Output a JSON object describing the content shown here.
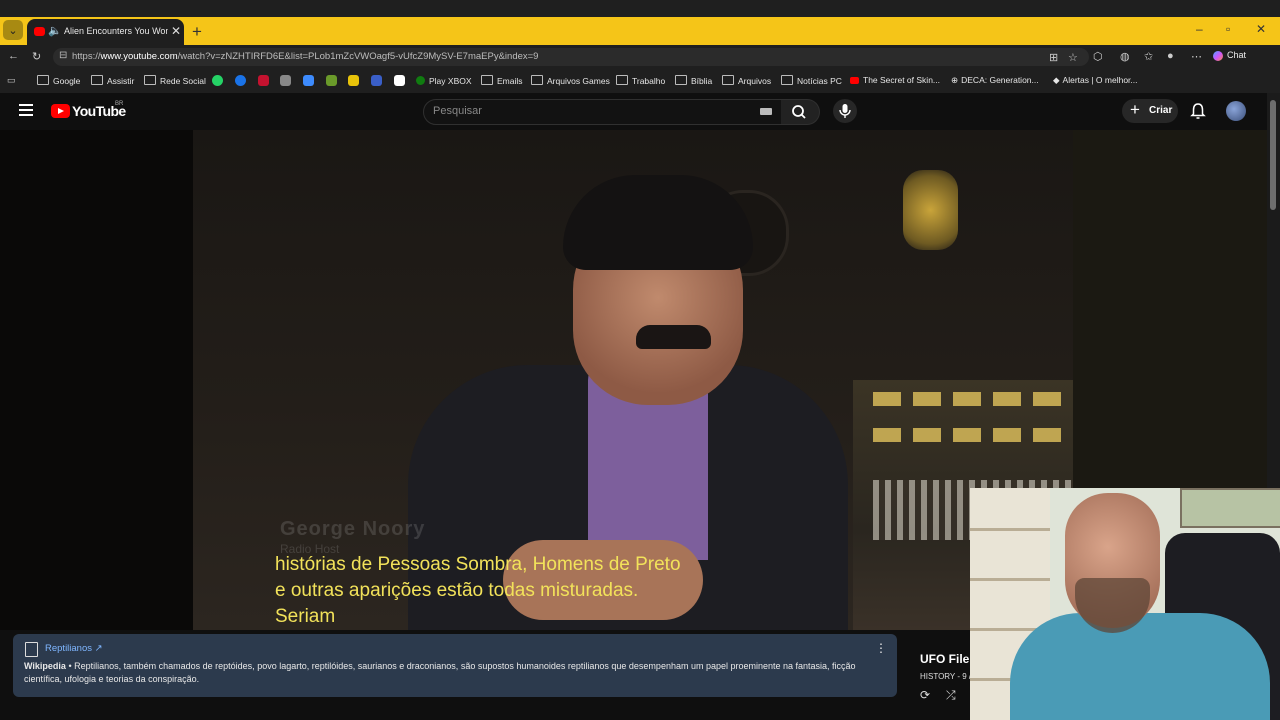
{
  "browser": {
    "tab_title": "Alien Encounters You Won't B",
    "url_prefix": "https://",
    "url_domain": "www.youtube.com",
    "url_rest": "/watch?v=zNZHTIRFD6E&list=PLob1mZcVWOagf5-vUfcZ9MySV-E7maEPy&index=9",
    "chat_label": "Chat"
  },
  "bookmarks": [
    {
      "label": "Google"
    },
    {
      "label": "Assistir"
    },
    {
      "label": "Rede Social"
    },
    {
      "label": "Play XBOX"
    },
    {
      "label": "Emails"
    },
    {
      "label": "Arquivos Games"
    },
    {
      "label": "Trabalho"
    },
    {
      "label": "Bíblia"
    },
    {
      "label": "Arquivos"
    },
    {
      "label": "Notícias PC"
    },
    {
      "label": "The Secret of Skin..."
    },
    {
      "label": "DECA: Generation..."
    },
    {
      "label": "Alertas | O melhor..."
    }
  ],
  "youtube": {
    "logo_text": "YouTube",
    "country": "BR",
    "search_placeholder": "Pesquisar",
    "create_label": "Criar"
  },
  "video": {
    "lower_third_name": "George Noory",
    "lower_third_role": "Radio Host",
    "subtitle_line1": "histórias de Pessoas Sombra, Homens de Preto",
    "subtitle_line2": "e outras aparições estão todas misturadas.",
    "subtitle_line3": "Seriam"
  },
  "info_panel": {
    "title": "Reptilianos ↗",
    "source": "Wikipedia",
    "text": " • Reptilianos, também chamados de reptóides, povo lagarto, reptilóides, saurianos e draconianos, são supostos humanoides reptilianos que desempenham um papel proeminente na fantasia, ficção científica, ufologia e teorias da conspiração."
  },
  "playlist": {
    "title": "UFO File",
    "channel": "HISTORY - 9 /"
  },
  "colors": {
    "tabstrip": "#f5c518",
    "subtitle": "#f2e25a",
    "wiki_panel": "#2c3a4d",
    "yt_red": "#ff0000"
  }
}
